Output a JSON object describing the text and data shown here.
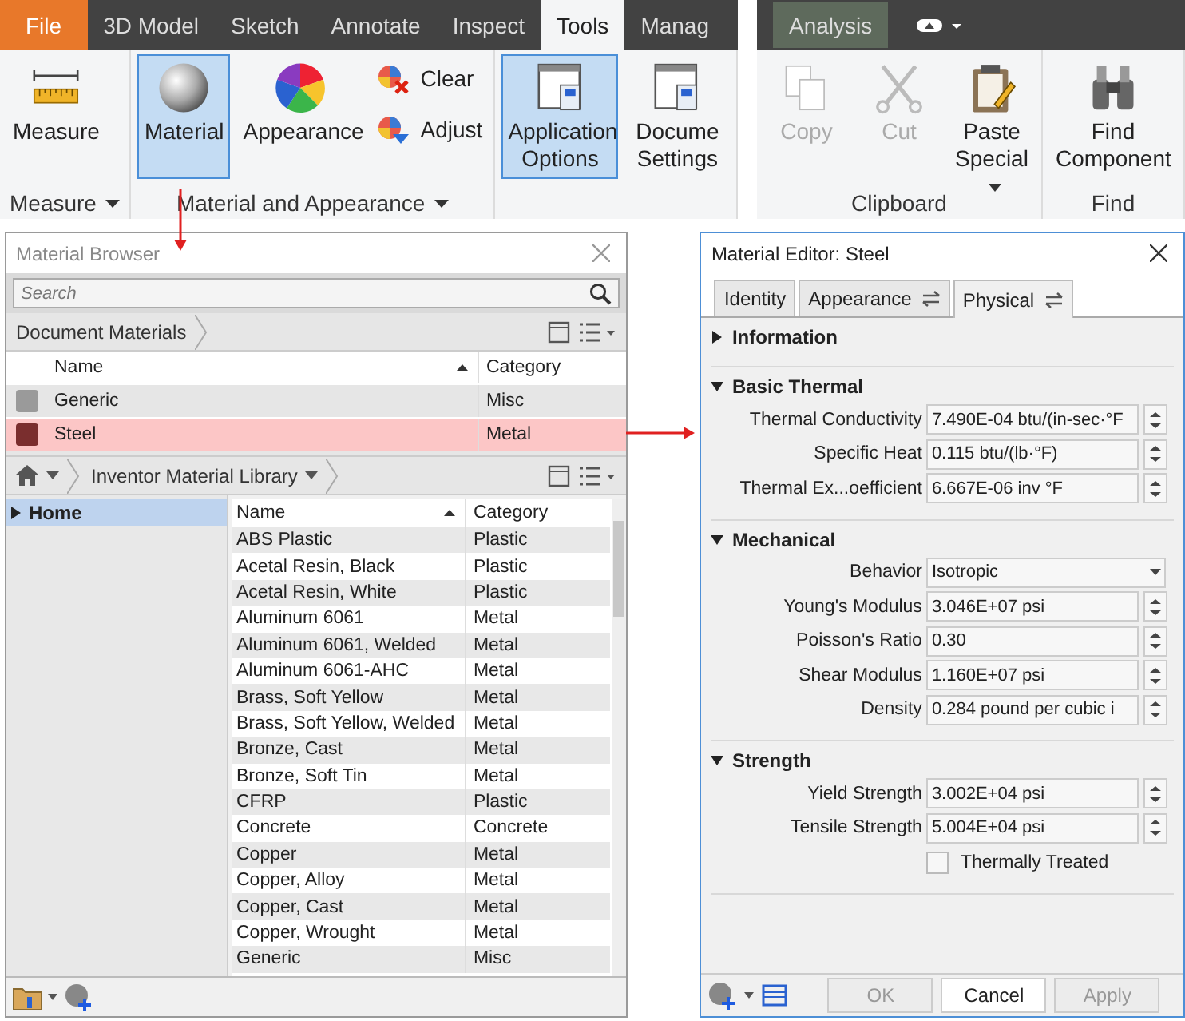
{
  "ribbon": {
    "left": {
      "tabs": [
        {
          "label": "File",
          "kind": "file",
          "selected": false
        },
        {
          "label": "3D Model",
          "kind": "normal",
          "selected": false
        },
        {
          "label": "Sketch",
          "kind": "normal",
          "selected": false
        },
        {
          "label": "Annotate",
          "kind": "normal",
          "selected": false
        },
        {
          "label": "Inspect",
          "kind": "normal",
          "selected": false
        },
        {
          "label": "Tools",
          "kind": "normal",
          "selected": true
        },
        {
          "label": "Manag",
          "kind": "normal",
          "selected": false
        }
      ],
      "groups": [
        {
          "label": "Measure",
          "dropdown": true,
          "buttons": [
            {
              "label": "Measure",
              "kind": "large",
              "selected": false
            }
          ]
        },
        {
          "label": "Material and Appearance",
          "dropdown": true,
          "buttons": [
            {
              "label": "Material",
              "kind": "large",
              "selected": true
            },
            {
              "label": "Appearance",
              "kind": "large",
              "selected": false
            },
            {
              "label": "Clear",
              "kind": "small",
              "selected": false
            },
            {
              "label": "Adjust",
              "kind": "small",
              "selected": false
            }
          ]
        },
        {
          "buttons": [
            {
              "label": "Application Options",
              "kind": "large",
              "selected": true
            },
            {
              "label": "Docume Settings",
              "kind": "large",
              "selected": false
            }
          ]
        }
      ]
    },
    "right": {
      "tabs": [
        {
          "label": "Analysis",
          "kind": "contextual",
          "selected": false
        }
      ],
      "groups": [
        {
          "label": "Clipboard",
          "buttons": [
            {
              "label": "Copy",
              "kind": "large",
              "disabled": true
            },
            {
              "label": "Cut",
              "kind": "large",
              "disabled": true
            },
            {
              "label": "Paste Special",
              "kind": "large",
              "dropdown": true
            }
          ]
        },
        {
          "label": "Find",
          "buttons": [
            {
              "label": "Find Component",
              "kind": "large"
            }
          ]
        }
      ]
    }
  },
  "material_browser": {
    "title": "Material Browser",
    "search": {
      "placeholder": "Search"
    },
    "document_materials": {
      "breadcrumb": "Document Materials",
      "columns": [
        "Name",
        "Category"
      ],
      "rows": [
        {
          "name": "Generic",
          "category": "Misc",
          "color": "#9a9a9a",
          "selected": false
        },
        {
          "name": "Steel",
          "category": "Metal",
          "color": "#7a2e2e",
          "selected": true
        }
      ]
    },
    "library": {
      "breadcrumb": "Inventor Material Library",
      "tree": [
        {
          "label": "Home",
          "selected": true,
          "expanded": false
        }
      ],
      "columns": [
        "Name",
        "Category"
      ],
      "rows": [
        {
          "name": "ABS Plastic",
          "category": "Plastic"
        },
        {
          "name": "Acetal Resin, Black",
          "category": "Plastic"
        },
        {
          "name": "Acetal Resin, White",
          "category": "Plastic"
        },
        {
          "name": "Aluminum 6061",
          "category": "Metal"
        },
        {
          "name": "Aluminum 6061, Welded",
          "category": "Metal"
        },
        {
          "name": "Aluminum 6061-AHC",
          "category": "Metal"
        },
        {
          "name": "Brass, Soft Yellow",
          "category": "Metal"
        },
        {
          "name": "Brass, Soft Yellow, Welded",
          "category": "Metal"
        },
        {
          "name": "Bronze, Cast",
          "category": "Metal"
        },
        {
          "name": "Bronze, Soft Tin",
          "category": "Metal"
        },
        {
          "name": "CFRP",
          "category": "Plastic"
        },
        {
          "name": "Concrete",
          "category": "Concrete"
        },
        {
          "name": "Copper",
          "category": "Metal"
        },
        {
          "name": "Copper, Alloy",
          "category": "Metal"
        },
        {
          "name": "Copper, Cast",
          "category": "Metal"
        },
        {
          "name": "Copper, Wrought",
          "category": "Metal"
        },
        {
          "name": "Generic",
          "category": "Misc"
        }
      ]
    }
  },
  "material_editor": {
    "title": "Material Editor: Steel",
    "tabs": [
      {
        "label": "Identity",
        "sync": false,
        "selected": false
      },
      {
        "label": "Appearance",
        "sync": true,
        "selected": false
      },
      {
        "label": "Physical",
        "sync": true,
        "selected": true
      }
    ],
    "sections": [
      {
        "title": "Information",
        "expanded": false
      },
      {
        "title": "Basic Thermal",
        "expanded": true,
        "properties": [
          {
            "kind": "spinner",
            "label": "Thermal Conductivity",
            "value": "7.490E-04 btu/(in-sec·°F"
          },
          {
            "kind": "spinner",
            "label": "Specific Heat",
            "value": "0.115 btu/(lb·°F)"
          },
          {
            "kind": "spinner",
            "label": "Thermal Ex...oefficient",
            "value": "6.667E-06 inv °F"
          }
        ]
      },
      {
        "title": "Mechanical",
        "expanded": true,
        "properties": [
          {
            "kind": "dropdown",
            "label": "Behavior",
            "value": "Isotropic"
          },
          {
            "kind": "spinner",
            "label": "Young's Modulus",
            "value": "3.046E+07 psi"
          },
          {
            "kind": "spinner",
            "label": "Poisson's Ratio",
            "value": "0.30"
          },
          {
            "kind": "spinner",
            "label": "Shear Modulus",
            "value": "1.160E+07 psi"
          },
          {
            "kind": "spinner",
            "label": "Density",
            "value": "0.284 pound per cubic i"
          }
        ]
      },
      {
        "title": "Strength",
        "expanded": true,
        "properties": [
          {
            "kind": "spinner",
            "label": "Yield Strength",
            "value": "3.002E+04 psi"
          },
          {
            "kind": "spinner",
            "label": "Tensile Strength",
            "value": "5.004E+04 psi"
          },
          {
            "kind": "checkbox",
            "label": "Thermally Treated",
            "checked": false
          }
        ]
      }
    ],
    "buttons": [
      {
        "label": "OK",
        "disabled": true
      },
      {
        "label": "Cancel",
        "disabled": false
      },
      {
        "label": "Apply",
        "disabled": true
      }
    ]
  }
}
